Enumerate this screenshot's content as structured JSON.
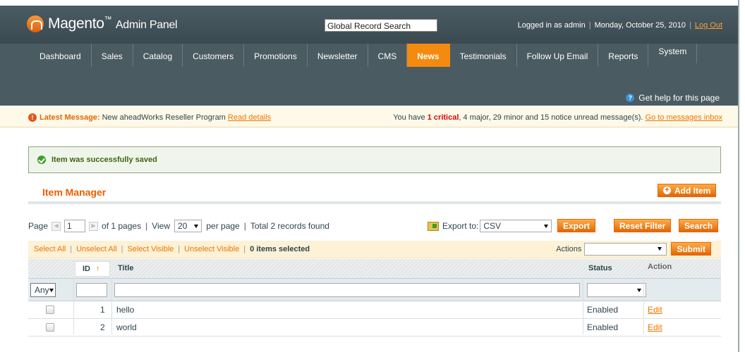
{
  "header": {
    "app_title": "Magento",
    "app_title_suffix": "Admin Panel",
    "global_search_value": "Global Record Search",
    "logged_in": "Logged in as admin",
    "date": "Monday, October 25, 2010",
    "logout": "Log Out"
  },
  "nav": {
    "items": [
      "Dashboard",
      "Sales",
      "Catalog",
      "Customers",
      "Promotions",
      "Newsletter",
      "CMS",
      "News",
      "Testimonials",
      "Follow Up Email",
      "Reports",
      "System"
    ],
    "active": "News",
    "help": "Get help for this page"
  },
  "messages": {
    "latest_label": "Latest Message:",
    "latest_text": "New aheadWorks Reseller Program",
    "read_details": "Read details",
    "summary_prefix": "You have",
    "critical": "1 critical",
    "summary_rest": ", 4 major, 29 minor and 15 notice unread message(s).",
    "inbox_link": "Go to messages inbox"
  },
  "success": "Item was successfully saved",
  "page": {
    "title": "Item Manager",
    "add_button": "Add Item"
  },
  "pager": {
    "page_label": "Page",
    "page_value": "1",
    "of_pages": "of 1 pages",
    "view_label": "View",
    "per_page_value": "20",
    "per_page_label": "per page",
    "total": "Total 2 records found"
  },
  "export": {
    "label": "Export to:",
    "format": "CSV",
    "export_button": "Export",
    "reset_button": "Reset Filter",
    "search_button": "Search"
  },
  "massaction": {
    "select_all": "Select All",
    "unselect_all": "Unselect All",
    "select_visible": "Select Visible",
    "unselect_visible": "Unselect Visible",
    "selected": "0 items selected",
    "actions_label": "Actions",
    "submit": "Submit"
  },
  "grid": {
    "columns": {
      "id": "ID",
      "title": "Title",
      "status": "Status",
      "action": "Action"
    },
    "filter_any": "Any",
    "rows": [
      {
        "id": "1",
        "title": "hello",
        "status": "Enabled",
        "action": "Edit"
      },
      {
        "id": "2",
        "title": "world",
        "status": "Enabled",
        "action": "Edit"
      }
    ]
  },
  "colors": {
    "accent": "#eb5e00",
    "nav_active": "#f48a0e",
    "header_bg": "#4b5b62"
  }
}
